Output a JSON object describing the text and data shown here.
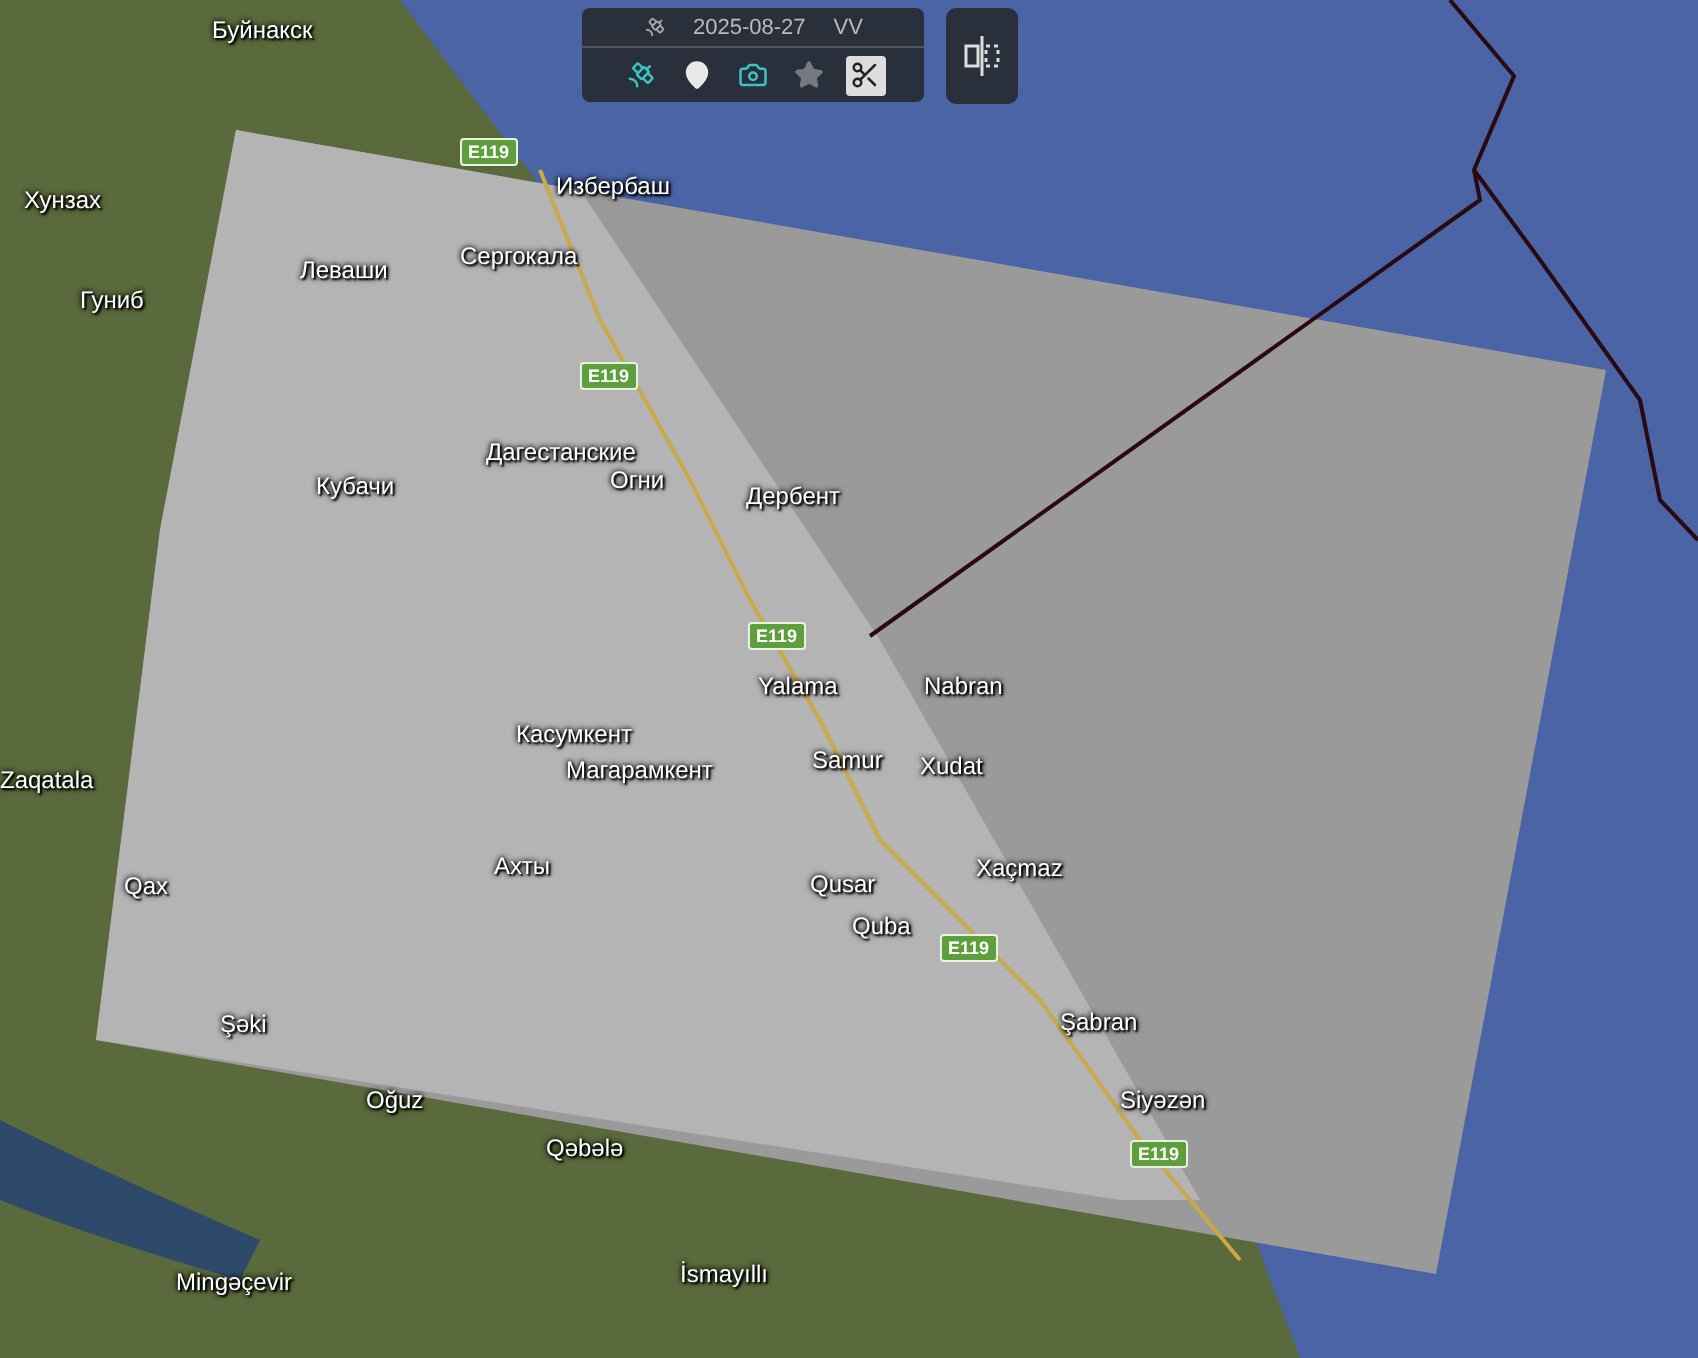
{
  "toolbar": {
    "date": "2025-08-27",
    "polarization": "VV",
    "tools": [
      {
        "kind": "satellite",
        "active": true,
        "disabled": false
      },
      {
        "kind": "pin",
        "active": false,
        "disabled": false
      },
      {
        "kind": "camera",
        "active": true,
        "disabled": false
      },
      {
        "kind": "star",
        "active": false,
        "disabled": true
      },
      {
        "kind": "cut",
        "active": false,
        "disabled": false
      }
    ]
  },
  "map_labels": [
    {
      "kind": "place",
      "text": "Буйнакск"
    },
    {
      "kind": "place",
      "text": "Хунзах"
    },
    {
      "kind": "road",
      "text": "E119"
    },
    {
      "kind": "place",
      "text": "Избербаш"
    },
    {
      "kind": "place",
      "text": "Леваши"
    },
    {
      "kind": "place",
      "text": "Сергокала"
    },
    {
      "kind": "place",
      "text": "Гуниб"
    },
    {
      "kind": "road",
      "text": "E119"
    },
    {
      "kind": "place",
      "text": "Дагестанские"
    },
    {
      "kind": "place",
      "text": "Огни"
    },
    {
      "kind": "place",
      "text": "Кубачи"
    },
    {
      "kind": "place",
      "text": "Дербент"
    },
    {
      "kind": "road",
      "text": "E119"
    },
    {
      "kind": "place",
      "text": "Yalama"
    },
    {
      "kind": "place",
      "text": "Nabran"
    },
    {
      "kind": "place",
      "text": "Касумкент"
    },
    {
      "kind": "place",
      "text": "Магарамкент"
    },
    {
      "kind": "place",
      "text": "Samur"
    },
    {
      "kind": "place",
      "text": "Xudat"
    },
    {
      "kind": "place",
      "text": "Zaqatala"
    },
    {
      "kind": "place",
      "text": "Ахты"
    },
    {
      "kind": "place",
      "text": "Qusar"
    },
    {
      "kind": "place",
      "text": "Xaçmaz"
    },
    {
      "kind": "place",
      "text": "Qax"
    },
    {
      "kind": "place",
      "text": "Quba"
    },
    {
      "kind": "road",
      "text": "E119"
    },
    {
      "kind": "place",
      "text": "Şəki"
    },
    {
      "kind": "place",
      "text": "Şabran"
    },
    {
      "kind": "place",
      "text": "Oğuz"
    },
    {
      "kind": "place",
      "text": "Siyəzən"
    },
    {
      "kind": "road",
      "text": "E119"
    },
    {
      "kind": "place",
      "text": "Qəbələ"
    },
    {
      "kind": "place",
      "text": "İsmayıllı"
    },
    {
      "kind": "place",
      "text": "Mingəçevir"
    }
  ]
}
